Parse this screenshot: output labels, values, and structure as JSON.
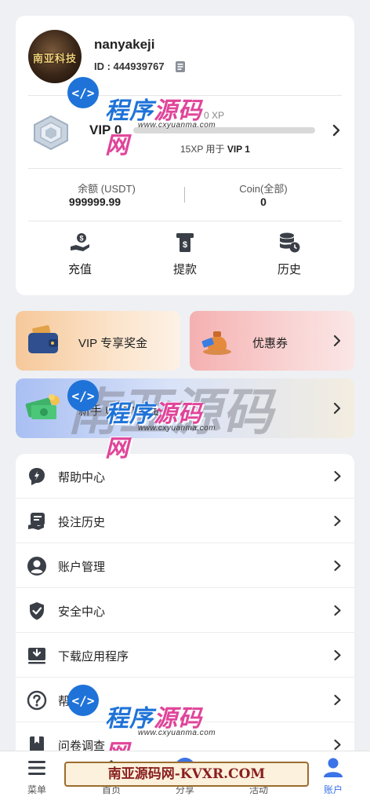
{
  "profile": {
    "avatar_text": "南亚科技",
    "username": "nanyakeji",
    "user_id": "ID : 444939767"
  },
  "vip": {
    "level": "VIP 0",
    "xp_current": "0 XP",
    "xp_target_prefix": "15XP 用于",
    "xp_target_level": "VIP 1",
    "progress": 0
  },
  "balances": [
    {
      "label": "余额 (USDT)",
      "value": "999999.99"
    },
    {
      "label": "Coin(全部)",
      "value": "0"
    }
  ],
  "actions": [
    {
      "label": "充值",
      "icon": "deposit-icon"
    },
    {
      "label": "提款",
      "icon": "withdraw-icon"
    },
    {
      "label": "历史",
      "icon": "history-icon"
    }
  ],
  "promos": {
    "vip_bonus": "VIP 专享奖金",
    "coupon": "优惠券",
    "usdt_bonus": "新手 USDT奖金"
  },
  "menu": [
    {
      "label": "帮助中心",
      "icon": "help-center-icon"
    },
    {
      "label": "投注历史",
      "icon": "bet-history-icon"
    },
    {
      "label": "账户管理",
      "icon": "account-icon"
    },
    {
      "label": "安全中心",
      "icon": "shield-icon"
    },
    {
      "label": "下载应用程序",
      "icon": "download-icon"
    },
    {
      "label": "帮助",
      "icon": "question-icon"
    },
    {
      "label": "问卷调查",
      "icon": "survey-icon"
    }
  ],
  "bottom_nav": [
    {
      "label": "菜单",
      "icon": "menu-icon"
    },
    {
      "label": "首页",
      "icon": "home-icon"
    },
    {
      "label": "分享",
      "icon": "share-icon"
    },
    {
      "label": "活动",
      "icon": "activity-icon"
    },
    {
      "label": "账户",
      "icon": "user-icon"
    }
  ],
  "watermarks": {
    "brand": "程序",
    "brand_pink": "源码网",
    "url": "www.cxyuanma.com",
    "big": "南亚源码",
    "banner": "南亚源码网-KVXR.COM"
  },
  "colors": {
    "accent": "#3b73e8",
    "text": "#222222",
    "background": "#eef0f3"
  }
}
